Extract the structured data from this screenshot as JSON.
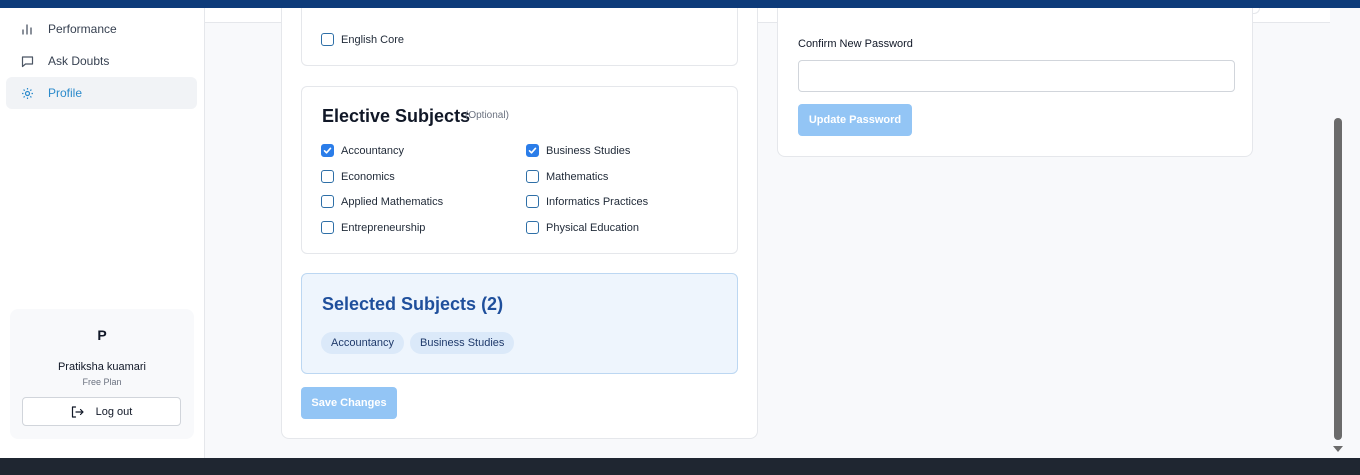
{
  "sidebar": {
    "items": [
      {
        "label": "Performance",
        "icon": "bar-chart-icon",
        "active": false
      },
      {
        "label": "Ask Doubts",
        "icon": "chat-bubble-icon",
        "active": false
      },
      {
        "label": "Profile",
        "icon": "gear-icon",
        "active": true
      }
    ],
    "user": {
      "initial": "P",
      "name": "Pratiksha kuamari",
      "plan": "Free Plan",
      "logout_label": "Log out"
    }
  },
  "core": {
    "items": [
      {
        "label": "English Core",
        "checked": false
      }
    ]
  },
  "elective": {
    "title": "Elective Subjects",
    "optional_label": "(Optional)",
    "items": [
      {
        "label": "Accountancy",
        "checked": true
      },
      {
        "label": "Business Studies",
        "checked": true
      },
      {
        "label": "Economics",
        "checked": false
      },
      {
        "label": "Mathematics",
        "checked": false
      },
      {
        "label": "Applied Mathematics",
        "checked": false
      },
      {
        "label": "Informatics Practices",
        "checked": false
      },
      {
        "label": "Entrepreneurship",
        "checked": false
      },
      {
        "label": "Physical Education",
        "checked": false
      }
    ]
  },
  "selected": {
    "title": "Selected Subjects (2)",
    "chips": [
      "Accountancy",
      "Business Studies"
    ]
  },
  "save_label": "Save Changes",
  "password": {
    "confirm_label": "Confirm New Password",
    "confirm_value": "",
    "update_label": "Update Password"
  },
  "colors": {
    "accent": "#2b8acb",
    "checkbox_checked": "#2b7de9",
    "disabled_button": "#93c5f5",
    "top_bar": "#0d3b7a"
  }
}
